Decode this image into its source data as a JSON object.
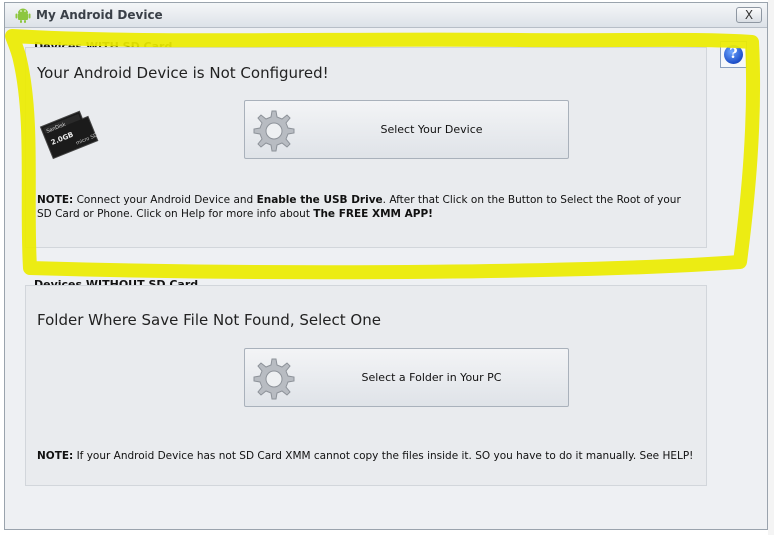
{
  "window": {
    "title": "My Android Device",
    "close_label": "X",
    "help_label": "?"
  },
  "section_with_sd": {
    "group_label": "Devices WITH SD Card",
    "headline": "Your Android Device is Not Configured!",
    "button_label": "Select Your Device",
    "note": {
      "prefix": "NOTE:",
      "text1": " Connect your Android Device and ",
      "bold1": "Enable the USB Drive",
      "text2": ". After that Click on the Button to Select the Root of your SD Card or Phone. Click on Help for more info about ",
      "bold2": "The FREE XMM APP!"
    },
    "sd_card_text": {
      "brand": "SanDisk",
      "capacity": "2.0GB",
      "type": "micro SD"
    }
  },
  "section_without_sd": {
    "group_label": "Devices WITHOUT SD Card",
    "headline": "Folder Where Save File Not Found, Select One",
    "button_label": "Select a Folder in Your PC",
    "note": {
      "prefix": "NOTE:",
      "text": " If your Android Device has not SD Card XMM cannot copy the files inside it. SO you have to do it manually. See HELP!"
    }
  },
  "colors": {
    "highlight": "#ecec00",
    "help_blue": "#1d4fc9"
  }
}
